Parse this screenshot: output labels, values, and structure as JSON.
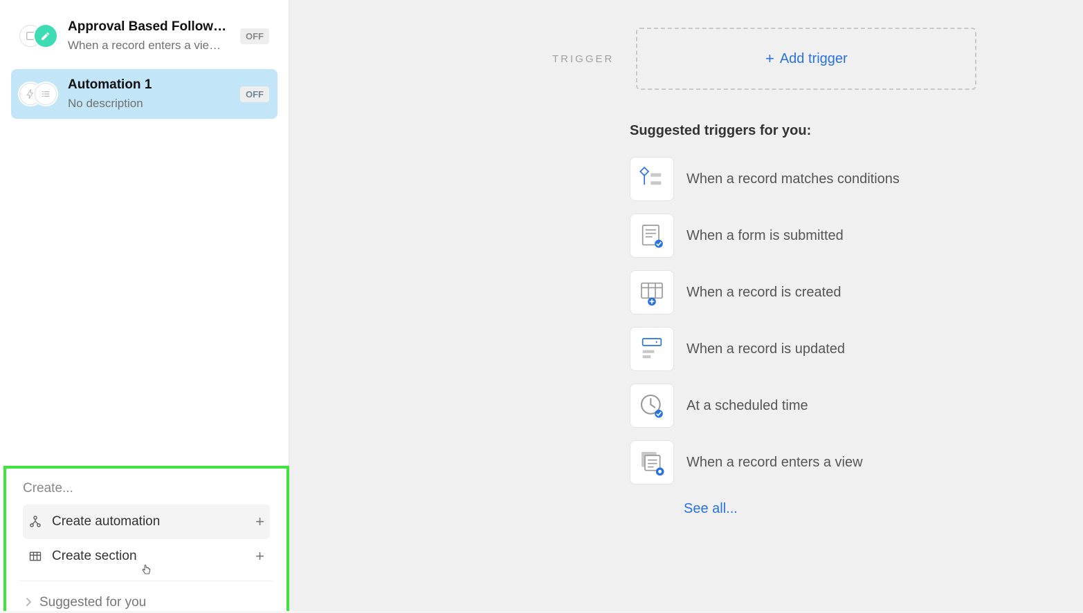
{
  "sidebar": {
    "automations": [
      {
        "title": "Approval Based Follow…",
        "description": "When a record enters a vie…",
        "status": "OFF"
      },
      {
        "title": "Automation 1",
        "description": "No description",
        "status": "OFF"
      }
    ],
    "create_panel": {
      "heading": "Create...",
      "automation_label": "Create automation",
      "section_label": "Create section",
      "suggested_label": "Suggested for you"
    }
  },
  "main": {
    "trigger_label": "TRIGGER",
    "add_trigger_label": "Add trigger",
    "suggested_heading": "Suggested triggers for you:",
    "triggers": [
      "When a record matches conditions",
      "When a form is submitted",
      "When a record is created",
      "When a record is updated",
      "At a scheduled time",
      "When a record enters a view"
    ],
    "see_all": "See all..."
  }
}
